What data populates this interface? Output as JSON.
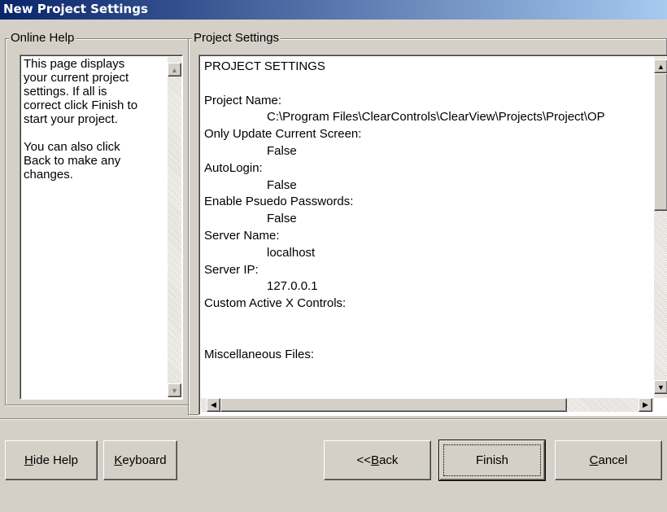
{
  "window": {
    "title": "New Project Settings"
  },
  "help": {
    "legend": "Online Help",
    "lines": [
      "This page displays",
      "your current project",
      "settings.  If all is",
      "correct click Finish to",
      "start your project.",
      "",
      "You can also click",
      "Back to make any",
      "changes."
    ]
  },
  "settings": {
    "legend": "Project Settings",
    "lines": [
      {
        "text": "PROJECT SETTINGS",
        "indent": false
      },
      {
        "text": "",
        "indent": false
      },
      {
        "text": "Project Name:",
        "indent": false
      },
      {
        "text": "C:\\Program Files\\ClearControls\\ClearView\\Projects\\Project\\OP",
        "indent": true
      },
      {
        "text": "Only Update Current Screen:",
        "indent": false
      },
      {
        "text": "False",
        "indent": true
      },
      {
        "text": "AutoLogin:",
        "indent": false
      },
      {
        "text": "False",
        "indent": true
      },
      {
        "text": "Enable Psuedo Passwords:",
        "indent": false
      },
      {
        "text": "False",
        "indent": true
      },
      {
        "text": "Server Name:",
        "indent": false
      },
      {
        "text": "localhost",
        "indent": true
      },
      {
        "text": "Server IP:",
        "indent": false
      },
      {
        "text": "127.0.0.1",
        "indent": true
      },
      {
        "text": "Custom Active X Controls:",
        "indent": false
      },
      {
        "text": "",
        "indent": false
      },
      {
        "text": "",
        "indent": false
      },
      {
        "text": "Miscellaneous Files:",
        "indent": false
      }
    ]
  },
  "buttons": {
    "hide_help": {
      "acc": "H",
      "rest": "ide Help"
    },
    "keyboard": {
      "acc": "K",
      "rest": "eyboard"
    },
    "back": {
      "pre": "<<",
      "acc": "B",
      "rest": "ack"
    },
    "finish": {
      "label": "Finish"
    },
    "cancel": {
      "acc": "C",
      "rest": "ancel"
    }
  },
  "icons": {
    "scroll_up": "▲",
    "scroll_down": "▼",
    "scroll_left": "◀",
    "scroll_right": "▶"
  }
}
